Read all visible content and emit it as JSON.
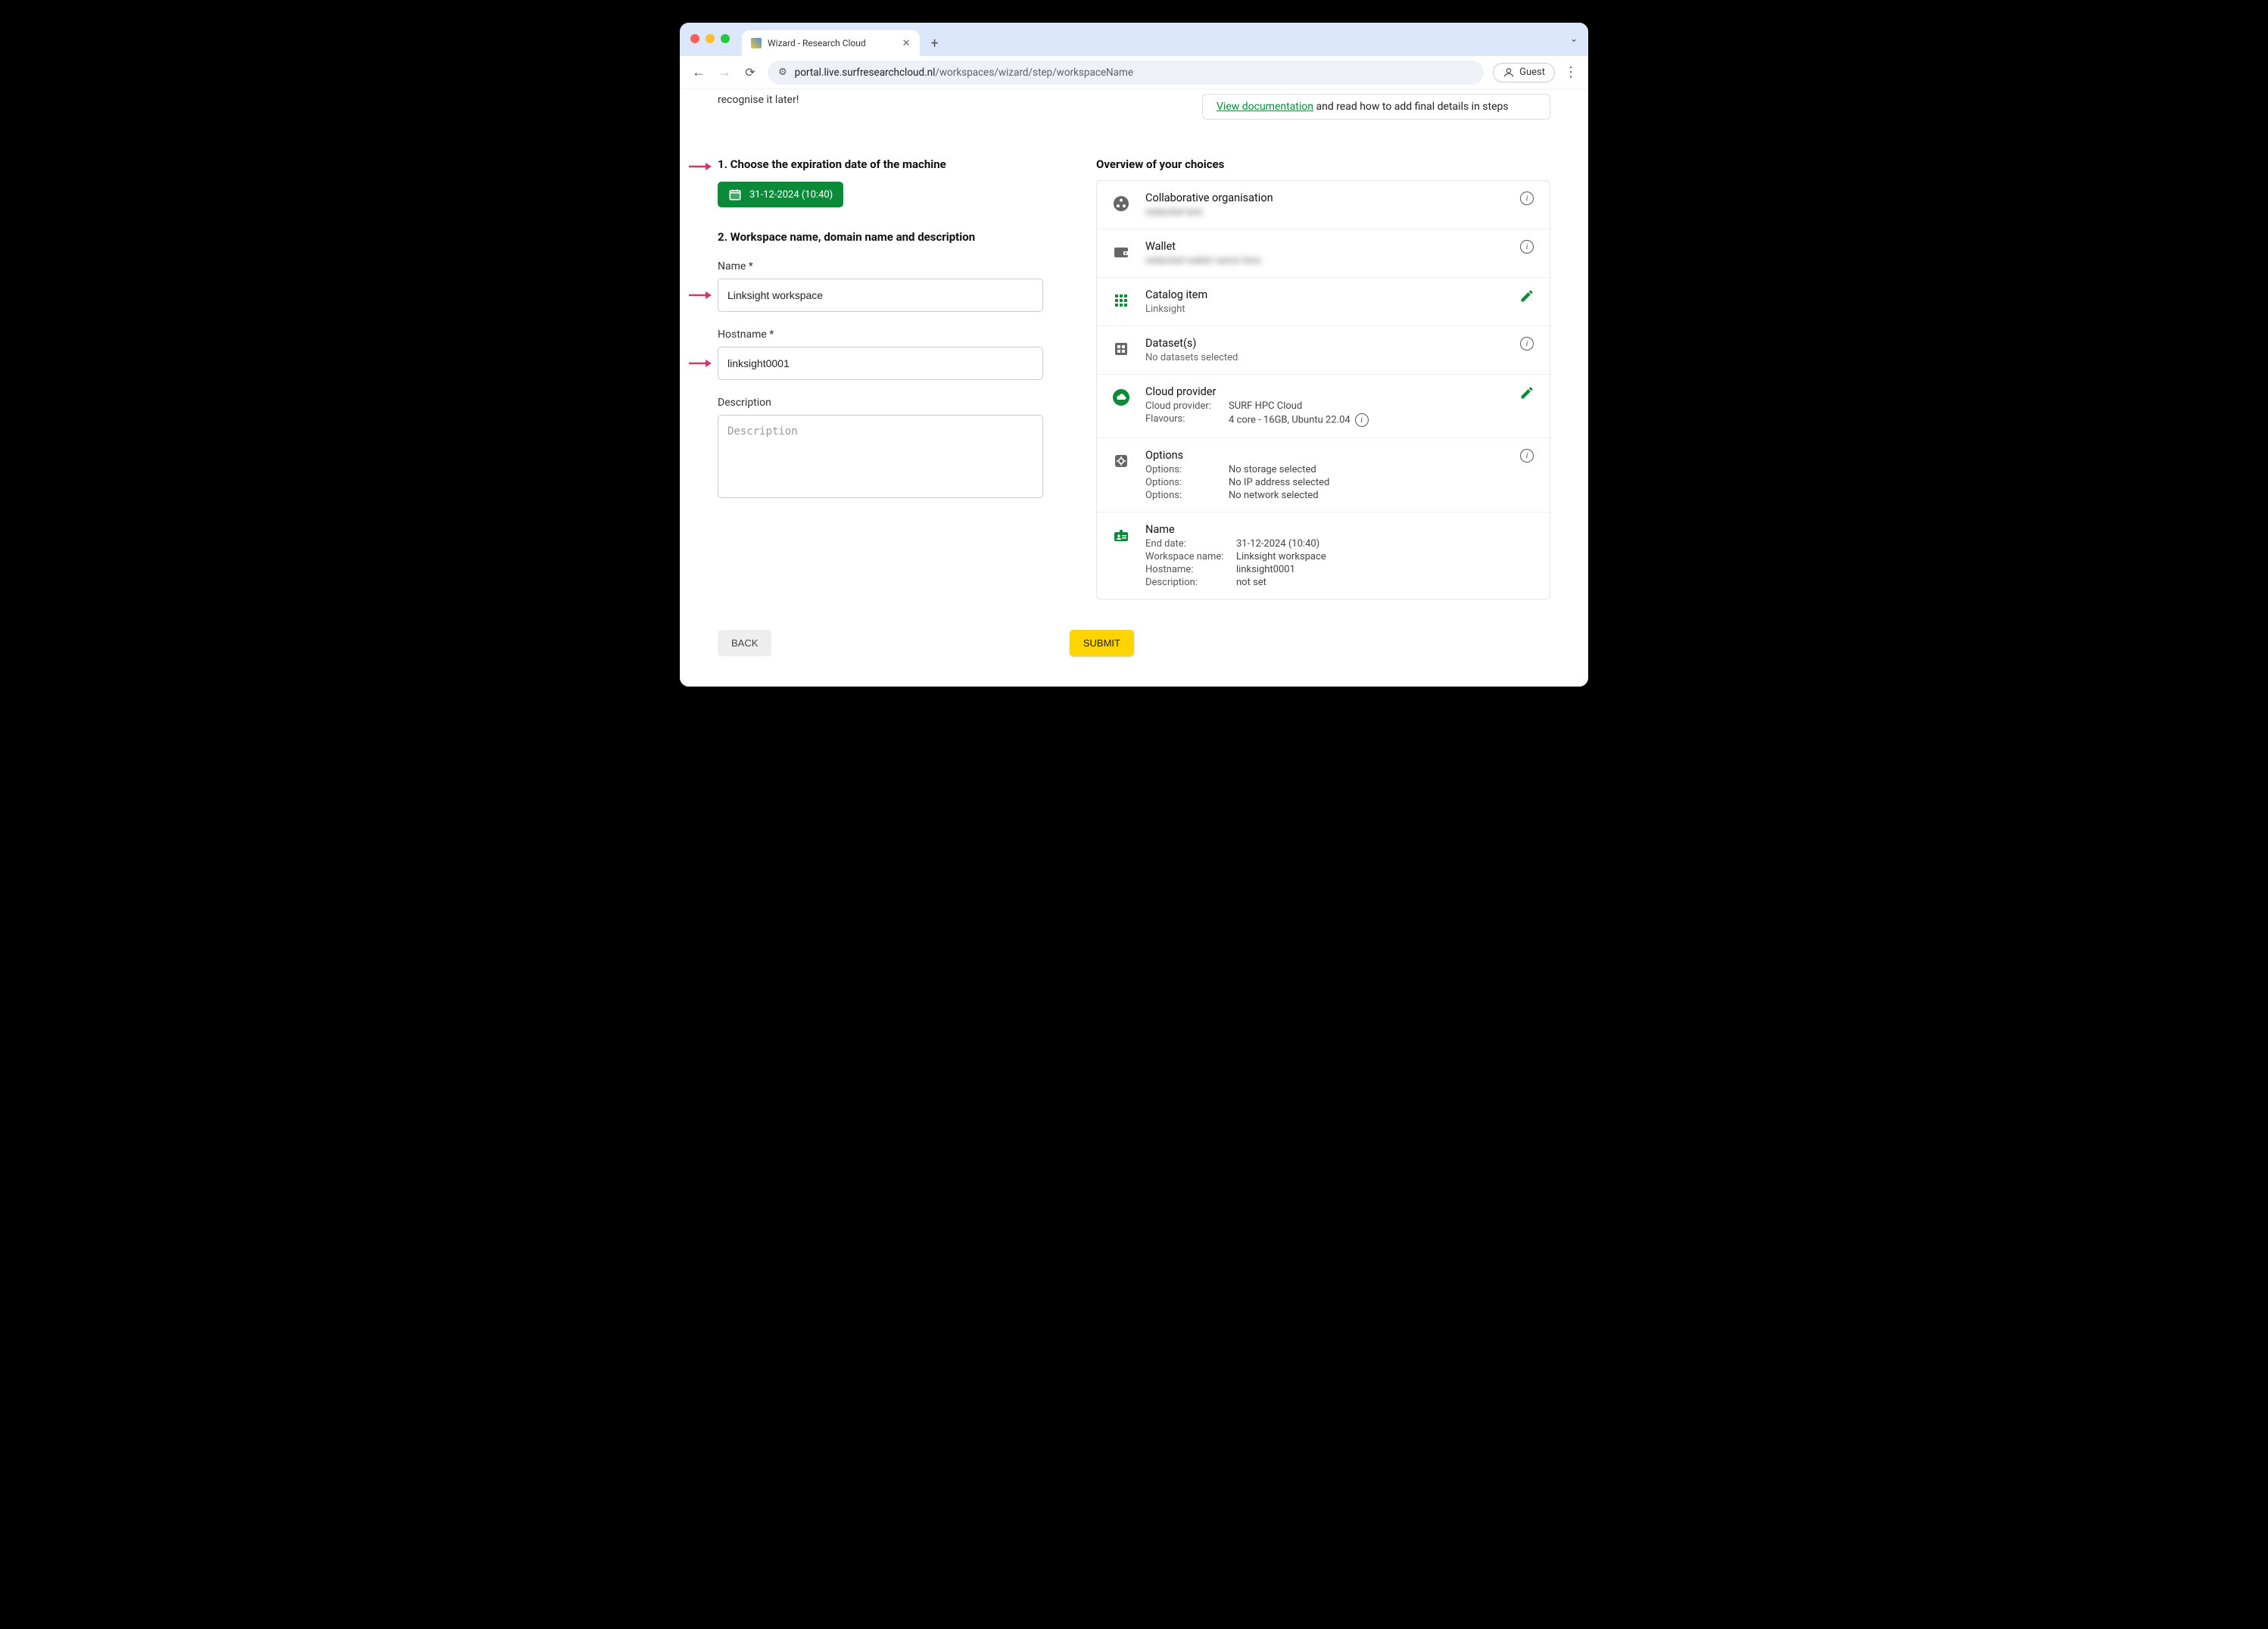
{
  "browser": {
    "tab_title": "Wizard - Research Cloud",
    "url_host": "portal.live.surfresearchcloud.nl",
    "url_path": "/workspaces/wizard/step/workspaceName",
    "guest_label": "Guest"
  },
  "top": {
    "recognise_text": "recognise it later!",
    "docbox_link": "View documentation",
    "docbox_rest": " and read how to add final details in steps"
  },
  "form": {
    "section1_title": "1. Choose the expiration date of the machine",
    "date_value": "31-12-2024 (10:40)",
    "section2_title": "2. Workspace name, domain name and description",
    "name_label": "Name *",
    "name_value": "Linksight workspace",
    "hostname_label": "Hostname *",
    "hostname_value": "linksight0001",
    "description_label": "Description",
    "description_placeholder": "Description",
    "description_value": ""
  },
  "overview": {
    "heading": "Overview of your choices",
    "rows": {
      "co": {
        "title": "Collaborative organisation",
        "sub": "redacted text"
      },
      "wallet": {
        "title": "Wallet",
        "sub": "redacted wallet name here"
      },
      "catalog": {
        "title": "Catalog item",
        "sub": "Linksight"
      },
      "datasets": {
        "title": "Dataset(s)",
        "sub": "No datasets selected"
      },
      "cloud": {
        "title": "Cloud provider",
        "k1": "Cloud provider:",
        "v1": "SURF HPC Cloud",
        "k2": "Flavours:",
        "v2": "4 core - 16GB, Ubuntu 22.04"
      },
      "options": {
        "title": "Options",
        "k": "Options:",
        "v1": "No storage selected",
        "v2": "No IP address selected",
        "v3": "No network selected"
      },
      "name": {
        "title": "Name",
        "k1": "End date:",
        "v1": "31-12-2024 (10:40)",
        "k2": "Workspace name:",
        "v2": "Linksight workspace",
        "k3": "Hostname:",
        "v3": "linksight0001",
        "k4": "Description:",
        "v4": "not set"
      }
    }
  },
  "buttons": {
    "back": "BACK",
    "submit": "SUBMIT"
  }
}
